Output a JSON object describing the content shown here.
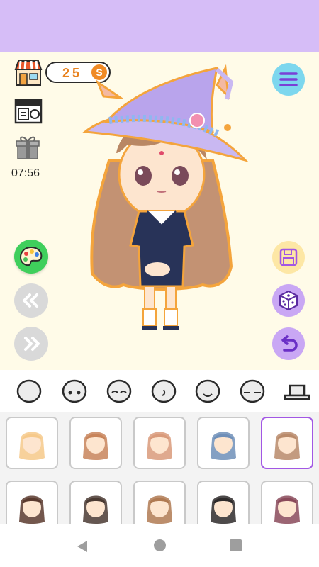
{
  "coins": {
    "value": "25",
    "symbol": "S"
  },
  "timer": "07:56",
  "categories": [
    {
      "name": "face-shape"
    },
    {
      "name": "eyes"
    },
    {
      "name": "eyes-closed"
    },
    {
      "name": "mouth"
    },
    {
      "name": "face-expression"
    },
    {
      "name": "sleepy-face"
    },
    {
      "name": "hat"
    }
  ],
  "hair_items": [
    {
      "row": 0,
      "col": 0,
      "color": "#f6c98a",
      "selected": false
    },
    {
      "row": 0,
      "col": 1,
      "color": "#c8845a",
      "selected": false
    },
    {
      "row": 0,
      "col": 2,
      "color": "#d99a7a",
      "selected": false
    },
    {
      "row": 0,
      "col": 3,
      "color": "#6f8fb8",
      "selected": false
    },
    {
      "row": 0,
      "col": 4,
      "color": "#b98a6a",
      "selected": true
    },
    {
      "row": 1,
      "col": 0,
      "color": "#5a3a2e",
      "selected": false
    },
    {
      "row": 1,
      "col": 1,
      "color": "#4a3a32",
      "selected": false
    },
    {
      "row": 1,
      "col": 2,
      "color": "#b07a52",
      "selected": false
    },
    {
      "row": 1,
      "col": 3,
      "color": "#2e2a2a",
      "selected": false
    },
    {
      "row": 1,
      "col": 4,
      "color": "#8a4a5a",
      "selected": false
    }
  ],
  "colors": {
    "topbar": "#d6bdf7",
    "accent_purple": "#a257e4",
    "menu": "#7dd7ee",
    "palette": "#3fcf5c",
    "coin": "#f08a24"
  }
}
